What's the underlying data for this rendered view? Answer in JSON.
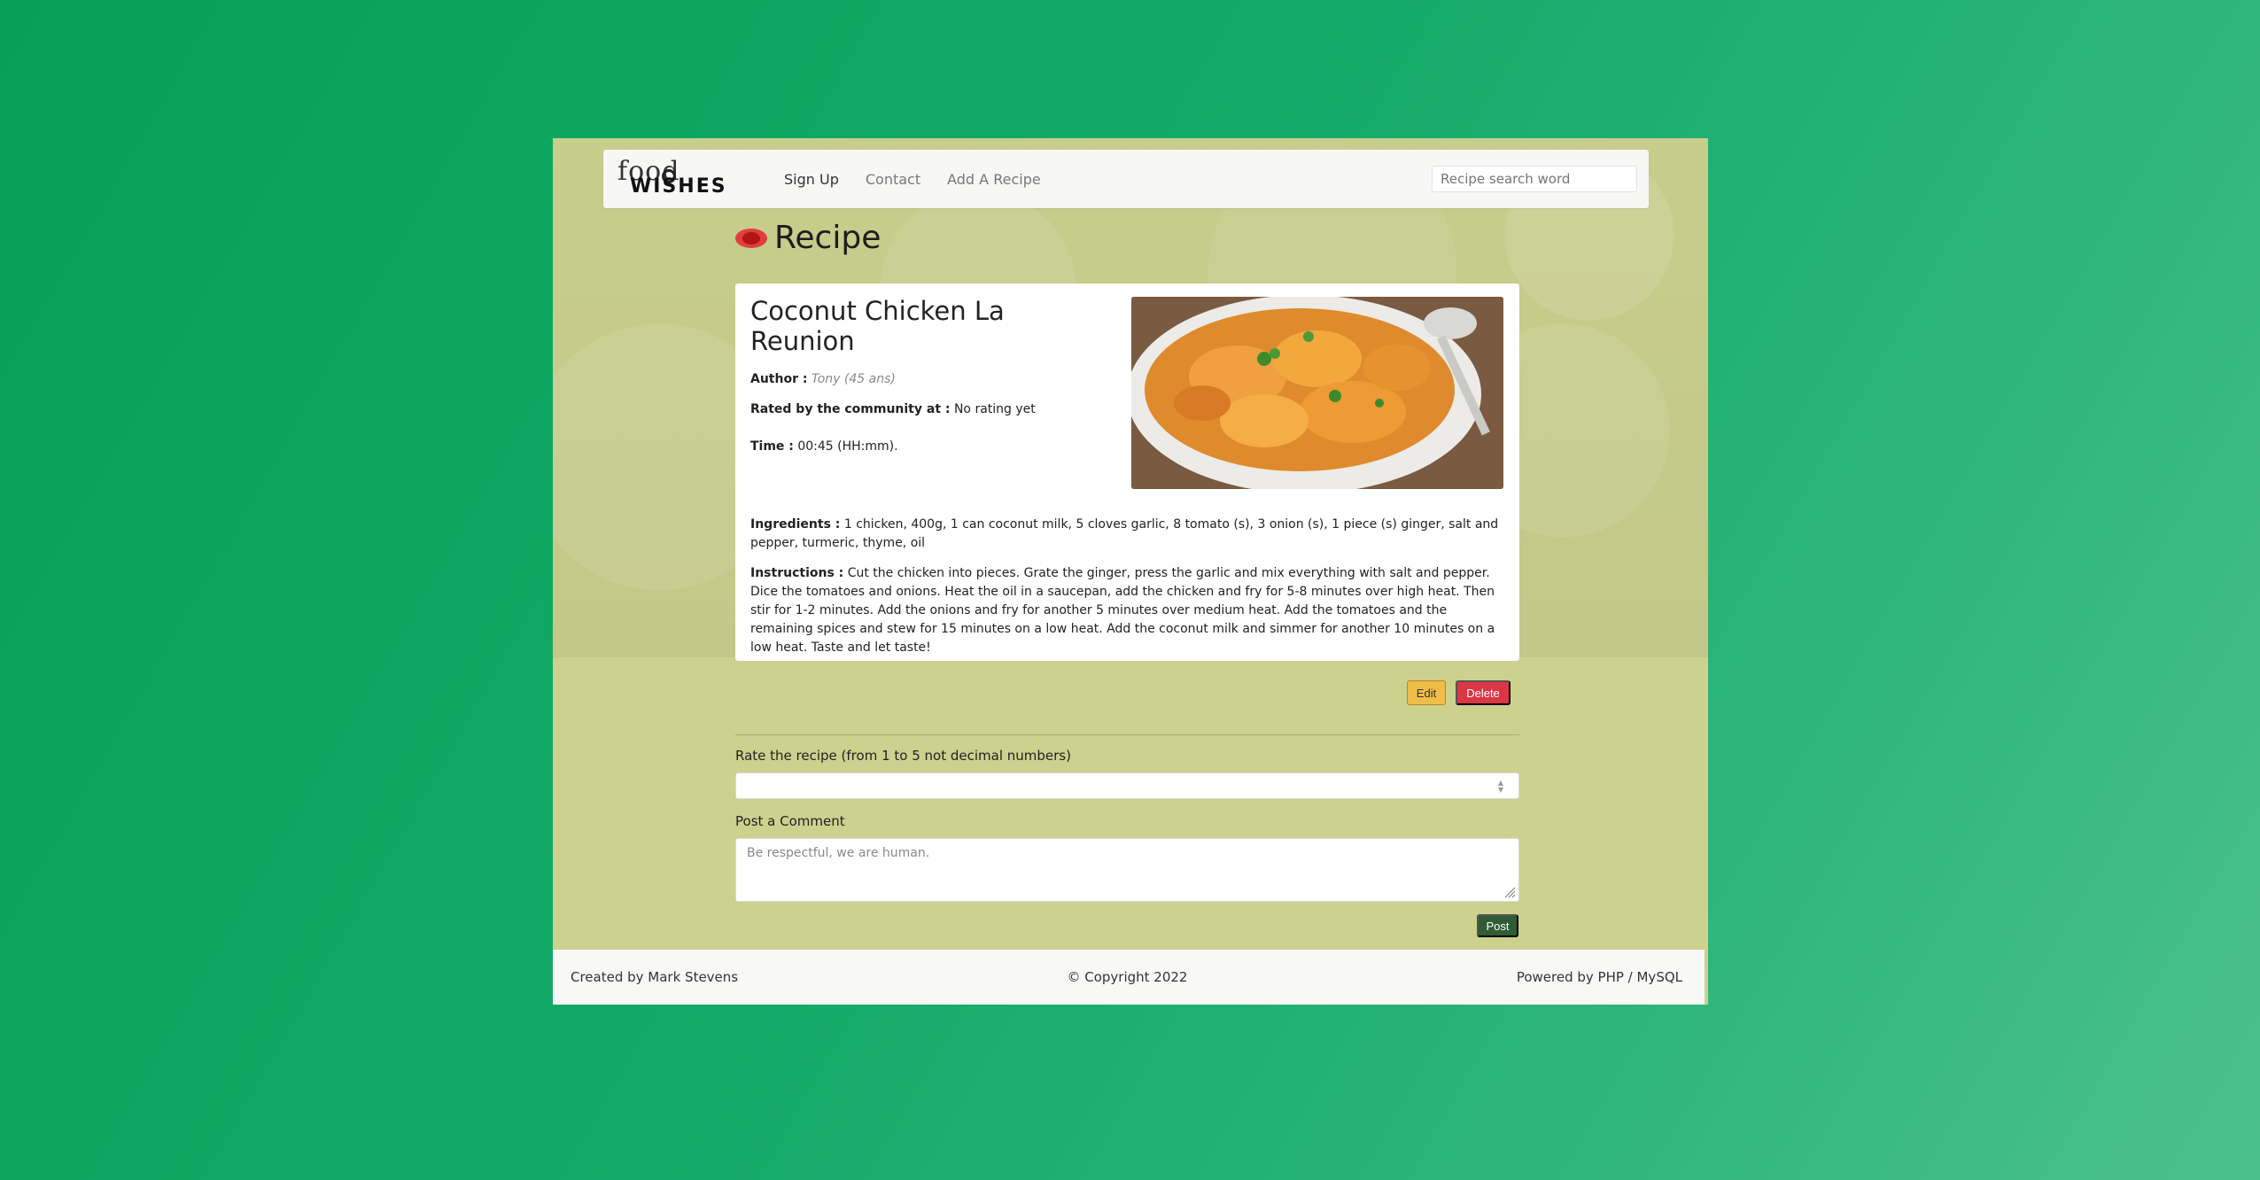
{
  "navbar": {
    "logo_top": "food",
    "logo_bottom": "WISHES",
    "links": [
      "Sign Up",
      "Contact",
      "Add A Recipe"
    ],
    "search_placeholder": "Recipe search word"
  },
  "page": {
    "title": "Recipe"
  },
  "recipe": {
    "name": "Coconut Chicken La Reunion",
    "author_label": "Author :",
    "author_value": "Tony (45 ans)",
    "rating_label": "Rated by the community at :",
    "rating_value": "No rating yet",
    "time_label": "Time :",
    "time_value": "00:45 (HH:mm).",
    "ingredients_label": "Ingredients :",
    "ingredients_value": "1 chicken, 400g, 1 can coconut milk, 5 cloves garlic, 8 tomato (s), 3 onion (s), 1 piece (s) ginger, salt and pepper, turmeric, thyme, oil",
    "instructions_label": "Instructions :",
    "instructions_value": "Cut the chicken into pieces. Grate the ginger, press the garlic and mix everything with salt and pepper. Dice the tomatoes and onions. Heat the oil in a saucepan, add the chicken and fry for 5-8 minutes over high heat. Then stir for 1-2 minutes. Add the onions and fry for another 5 minutes over medium heat. Add the tomatoes and the remaining spices and stew for 15 minutes on a low heat. Add the coconut milk and simmer for another 10 minutes on a low heat. Taste and let taste!"
  },
  "actions": {
    "edit": "Edit",
    "delete": "Delete"
  },
  "form": {
    "rate_label": "Rate the recipe (from 1 to 5 not decimal numbers)",
    "comment_label": "Post a Comment",
    "comment_placeholder": "Be respectful, we are human.",
    "post": "Post"
  },
  "footer": {
    "left": "Created by Mark Stevens",
    "center": "© Copyright 2022",
    "right": "Powered by PHP / MySQL"
  }
}
